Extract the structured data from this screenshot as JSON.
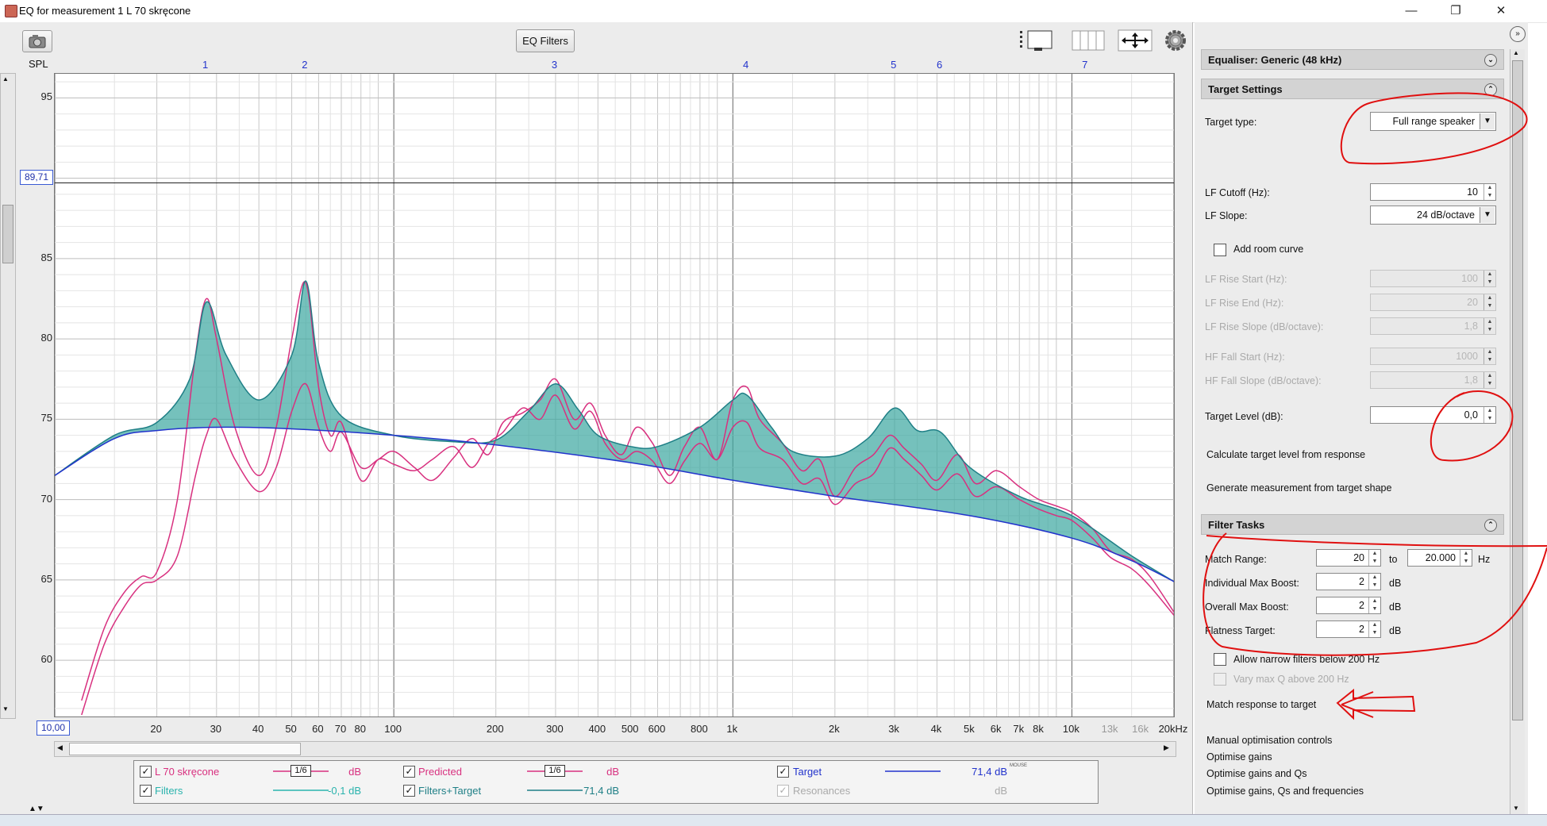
{
  "window": {
    "title": "EQ for measurement 1 L 70 skręcone",
    "minimize": "—",
    "maximize": "❐",
    "close": "✕"
  },
  "toolbar": {
    "eq_filters_label": "EQ Filters",
    "camera_icon": "camera-icon",
    "spl_label": "SPL",
    "gear_icon": "gear-icon"
  },
  "filter_numbers": [
    "1",
    "2",
    "3",
    "4",
    "5",
    "6",
    "7"
  ],
  "cursor_value": "89,71",
  "x_start_value": "10,00",
  "legend": {
    "row1": [
      {
        "name": "L 70 skręcone",
        "smoothing": "1/6",
        "value": "dB",
        "checked": true,
        "color": "#d8307f"
      },
      {
        "name": "Predicted",
        "smoothing": "1/6",
        "value": "dB",
        "checked": true,
        "color": "#d8307f"
      },
      {
        "name": "Target",
        "value": "71,4 dB",
        "sup": "MOUSE",
        "checked": true,
        "color": "#2233cc"
      }
    ],
    "row2": [
      {
        "name": "Filters",
        "value": "-0,1 dB",
        "checked": true,
        "color": "#2ab3ad"
      },
      {
        "name": "Filters+Target",
        "value": "71,4 dB",
        "checked": true,
        "color": "#1f7f86"
      },
      {
        "name": "Resonances",
        "value": "dB",
        "checked": true,
        "color": "#aaaaaa"
      }
    ]
  },
  "panel": {
    "equaliser_header": "Equaliser: Generic (48 kHz)",
    "target_settings_header": "Target Settings",
    "target_type_label": "Target type:",
    "target_type_value": "Full range speaker",
    "lf_cutoff_label": "LF Cutoff (Hz):",
    "lf_cutoff_value": "10",
    "lf_slope_label": "LF Slope:",
    "lf_slope_value": "24 dB/octave",
    "add_room_curve_label": "Add room curve",
    "lf_rise_start_label": "LF Rise Start (Hz):",
    "lf_rise_start_value": "100",
    "lf_rise_end_label": "LF Rise End (Hz):",
    "lf_rise_end_value": "20",
    "lf_rise_slope_label": "LF Rise Slope (dB/octave):",
    "lf_rise_slope_value": "1,8",
    "hf_fall_start_label": "HF Fall Start (Hz):",
    "hf_fall_start_value": "1000",
    "hf_fall_slope_label": "HF Fall Slope (dB/octave):",
    "hf_fall_slope_value": "1,8",
    "target_level_label": "Target Level (dB):",
    "target_level_value": "0,0",
    "calc_target_label": "Calculate target level from response",
    "generate_measurement_label": "Generate measurement from target shape",
    "filter_tasks_header": "Filter Tasks",
    "match_range_label": "Match Range:",
    "match_range_from": "20",
    "match_range_to_label": "to",
    "match_range_to": "20.000",
    "hz_unit": "Hz",
    "ind_max_boost_label": "Individual Max Boost:",
    "ind_max_boost_value": "2",
    "overall_max_boost_label": "Overall Max Boost:",
    "overall_max_boost_value": "2",
    "flatness_target_label": "Flatness Target:",
    "flatness_target_value": "2",
    "db_unit": "dB",
    "allow_narrow_label": "Allow narrow filters below 200 Hz",
    "vary_max_q_label": "Vary max Q above 200 Hz",
    "match_response_label": "Match response to target",
    "manual_opt_label": "Manual optimisation controls",
    "opt_gains_label": "Optimise gains",
    "opt_gains_qs_label": "Optimise gains and Qs",
    "opt_gains_qs_freq_label": "Optimise gains, Qs and frequencies"
  },
  "chart_data": {
    "type": "line",
    "ylabel": "SPL",
    "ylim": [
      56.5,
      96.5
    ],
    "xlim": [
      10,
      20000
    ],
    "x_scale": "log",
    "grid": true,
    "y_ticks": [
      95,
      90,
      85,
      80,
      75,
      70,
      65,
      60
    ],
    "x_ticks": [
      {
        "v": 20,
        "l": "20"
      },
      {
        "v": 30,
        "l": "30"
      },
      {
        "v": 40,
        "l": "40"
      },
      {
        "v": 50,
        "l": "50"
      },
      {
        "v": 60,
        "l": "60"
      },
      {
        "v": 70,
        "l": "70"
      },
      {
        "v": 80,
        "l": "80"
      },
      {
        "v": 100,
        "l": "100"
      },
      {
        "v": 200,
        "l": "200"
      },
      {
        "v": 300,
        "l": "300"
      },
      {
        "v": 400,
        "l": "400"
      },
      {
        "v": 500,
        "l": "500"
      },
      {
        "v": 600,
        "l": "600"
      },
      {
        "v": 800,
        "l": "800"
      },
      {
        "v": 1000,
        "l": "1k"
      },
      {
        "v": 2000,
        "l": "2k"
      },
      {
        "v": 3000,
        "l": "3k"
      },
      {
        "v": 4000,
        "l": "4k"
      },
      {
        "v": 5000,
        "l": "5k"
      },
      {
        "v": 6000,
        "l": "6k"
      },
      {
        "v": 7000,
        "l": "7k"
      },
      {
        "v": 8000,
        "l": "8k"
      },
      {
        "v": 10000,
        "l": "10k"
      },
      {
        "v": 13000,
        "l": "13k"
      },
      {
        "v": 16000,
        "l": "16k"
      },
      {
        "v": 20000,
        "l": "20kHz"
      }
    ],
    "cursor_y": 89.71,
    "filter_marker_freqs": [
      28,
      55,
      300,
      1100,
      3000,
      4100,
      11000
    ],
    "series": [
      {
        "name": "Target",
        "color": "#2233cc",
        "x": [
          10,
          15,
          20,
          30,
          50,
          100,
          200,
          500,
          1000,
          2000,
          5000,
          10000,
          15000,
          20000
        ],
        "y": [
          71.5,
          73.8,
          74.3,
          74.5,
          74.4,
          74.0,
          73.4,
          72.3,
          71.2,
          70.2,
          69.0,
          67.6,
          66.2,
          64.9
        ]
      },
      {
        "name": "Filters+Target",
        "color": "#1f7f86",
        "fill": "#3aa7a0",
        "x": [
          10,
          15,
          20,
          25,
          28,
          32,
          40,
          50,
          55,
          60,
          70,
          100,
          150,
          200,
          250,
          300,
          350,
          400,
          500,
          600,
          800,
          1000,
          1100,
          1300,
          1500,
          2000,
          2500,
          3000,
          3500,
          4100,
          5000,
          7000,
          10000,
          15000,
          20000
        ],
        "y": [
          71.5,
          74.0,
          74.8,
          77.5,
          82.3,
          79.0,
          76.2,
          79.0,
          83.6,
          78.5,
          75.2,
          74.0,
          73.6,
          73.7,
          75.5,
          77.2,
          75.6,
          74.0,
          73.3,
          73.3,
          74.5,
          76.2,
          76.5,
          74.5,
          73.0,
          72.7,
          73.8,
          75.7,
          74.3,
          74.2,
          72.0,
          70.2,
          69.0,
          66.5,
          64.9
        ]
      },
      {
        "name": "L 70 skręcone",
        "color": "#d8307f",
        "x": [
          12,
          14,
          16,
          18,
          20,
          23,
          26,
          28,
          30,
          34,
          40,
          45,
          50,
          55,
          60,
          65,
          70,
          80,
          90,
          100,
          115,
          130,
          150,
          170,
          190,
          210,
          240,
          270,
          300,
          340,
          380,
          420,
          470,
          520,
          580,
          650,
          720,
          800,
          900,
          1000,
          1100,
          1200,
          1400,
          1600,
          1800,
          2000,
          2300,
          2600,
          2900,
          3200,
          3600,
          4000,
          4600,
          5200,
          6000,
          7000,
          8000,
          9000,
          10000,
          11500,
          13000,
          15000,
          17000,
          20000
        ],
        "y": [
          56.6,
          61.0,
          63.3,
          64.7,
          65.0,
          66.5,
          71.5,
          74.0,
          75.0,
          72.5,
          70.5,
          72.0,
          75.5,
          77.2,
          74.5,
          73.0,
          74.2,
          72.0,
          72.5,
          73.0,
          72.0,
          71.2,
          72.6,
          73.8,
          72.8,
          74.8,
          75.4,
          76.2,
          77.5,
          75.0,
          76.0,
          74.0,
          72.8,
          74.5,
          73.5,
          71.5,
          73.3,
          74.5,
          72.5,
          76.2,
          77.0,
          75.0,
          73.5,
          71.8,
          72.5,
          70.2,
          72.0,
          72.8,
          74.0,
          73.2,
          72.2,
          71.2,
          72.8,
          71.0,
          71.8,
          70.8,
          70.0,
          69.6,
          69.2,
          68.2,
          66.8,
          66.3,
          65.2,
          63.0
        ]
      },
      {
        "name": "Predicted",
        "color": "#d8307f",
        "x": [
          12,
          14,
          16,
          18,
          20,
          23,
          26,
          28,
          30,
          34,
          40,
          45,
          50,
          55,
          60,
          65,
          70,
          80,
          90,
          100,
          115,
          130,
          150,
          170,
          190,
          210,
          240,
          270,
          300,
          340,
          380,
          420,
          470,
          520,
          580,
          650,
          720,
          800,
          900,
          1000,
          1100,
          1200,
          1400,
          1600,
          1800,
          2000,
          2300,
          2600,
          2900,
          3200,
          3600,
          4000,
          4600,
          5200,
          6000,
          7000,
          8000,
          9000,
          10000,
          11500,
          13000,
          15000,
          17000,
          20000
        ],
        "y": [
          57.5,
          62.0,
          64.2,
          65.2,
          65.5,
          70.0,
          79.0,
          82.5,
          80.0,
          74.5,
          71.5,
          74.5,
          80.0,
          83.5,
          77.0,
          74.0,
          74.8,
          71.2,
          72.5,
          72.2,
          71.8,
          72.5,
          73.3,
          72.0,
          73.5,
          74.2,
          75.7,
          75.0,
          76.5,
          74.4,
          75.5,
          73.5,
          72.5,
          73.0,
          72.4,
          71.0,
          72.4,
          73.5,
          72.5,
          74.5,
          74.8,
          73.2,
          72.5,
          71.0,
          71.3,
          69.7,
          71.0,
          71.6,
          73.2,
          72.5,
          71.5,
          70.6,
          71.6,
          70.2,
          70.8,
          70.0,
          69.4,
          69.0,
          68.7,
          67.6,
          66.4,
          65.7,
          64.6,
          62.8
        ]
      }
    ]
  }
}
